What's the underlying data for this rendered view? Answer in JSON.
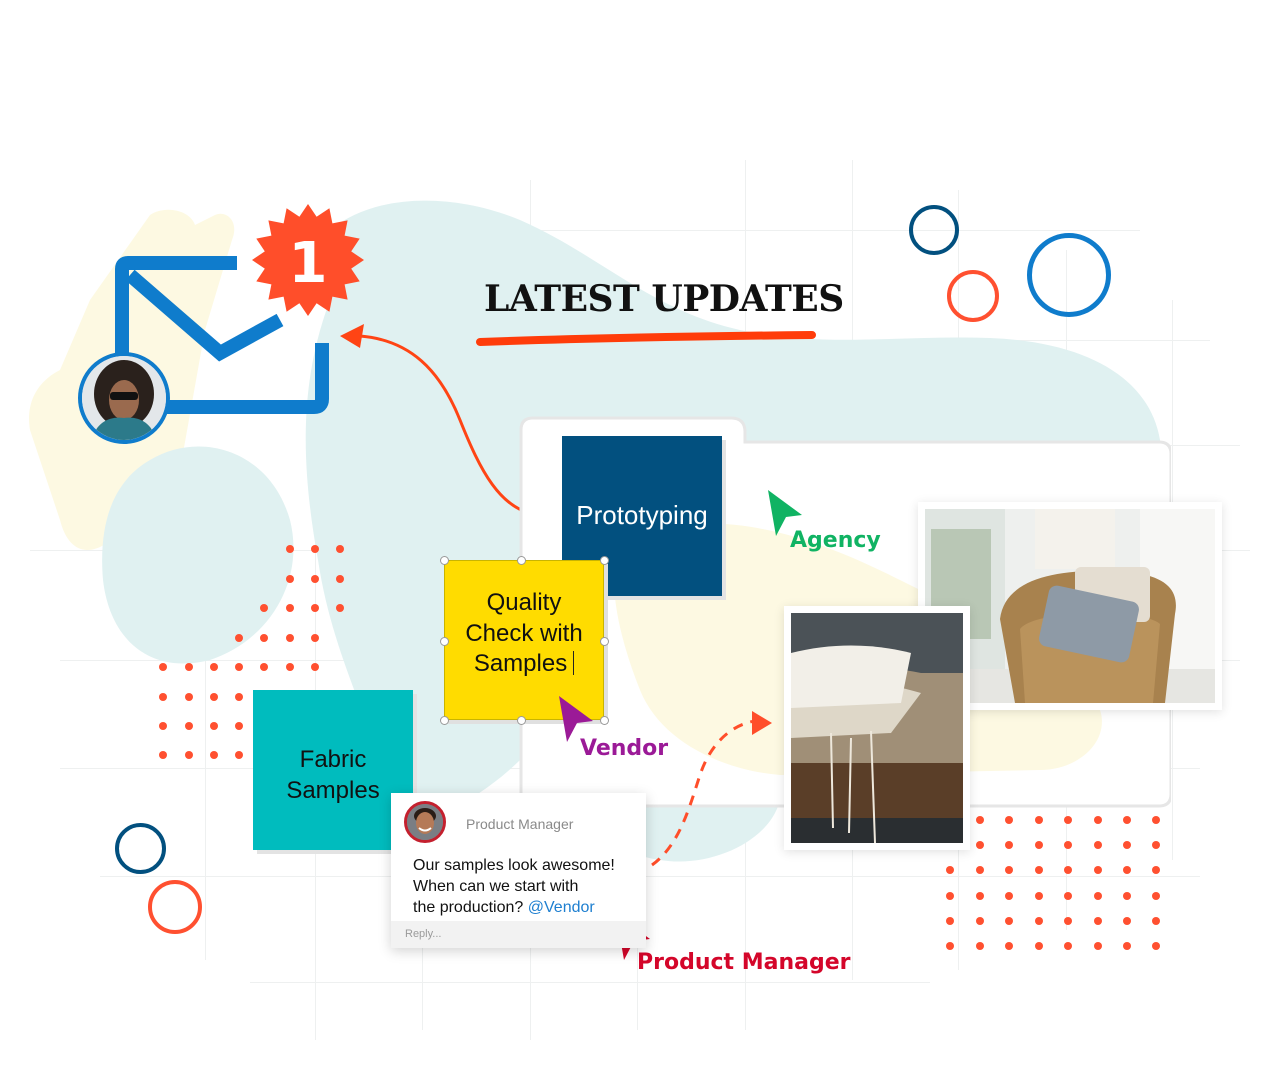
{
  "header": {
    "title": "LATEST UPDATES"
  },
  "notification": {
    "icon": "mail-icon",
    "badge_count": "1",
    "badge_color": "#ff4e2a"
  },
  "board": {
    "stickies": [
      {
        "label": "Prototyping",
        "color": "#02507f"
      },
      {
        "label": "Quality Check with Samples",
        "lines": [
          "Quality",
          "Check with",
          "Samples"
        ],
        "color": "#ffdc00"
      },
      {
        "label": "Fabric Samples",
        "lines": [
          "Fabric",
          "Samples"
        ],
        "color": "#00bcbe"
      }
    ],
    "cursors": [
      {
        "name": "Agency",
        "color": "#10b363"
      },
      {
        "name": "Vendor",
        "color": "#9b1a97"
      },
      {
        "name": "Product Manager",
        "color": "#d4062a"
      }
    ],
    "photos": [
      {
        "name": "wicker-chair-photo",
        "alt": "Wicker chair with pillows"
      },
      {
        "name": "fabric-stack-photo",
        "alt": "Stack of folded fabric samples"
      }
    ]
  },
  "comment": {
    "author": "Product Manager",
    "body": "Our samples look awesome! When can we start with the production?",
    "body_lines": [
      "Our samples look awesome!",
      "When can we start with",
      "the production?"
    ],
    "mention": "@Vendor",
    "reply_placeholder": "Reply..."
  },
  "colors": {
    "accent_orange": "#ff4e2a",
    "accent_blue": "#0f7ccc",
    "navy": "#02507f",
    "blob_mint": "#e0f1f1",
    "blob_cream": "#fdf9e2"
  }
}
